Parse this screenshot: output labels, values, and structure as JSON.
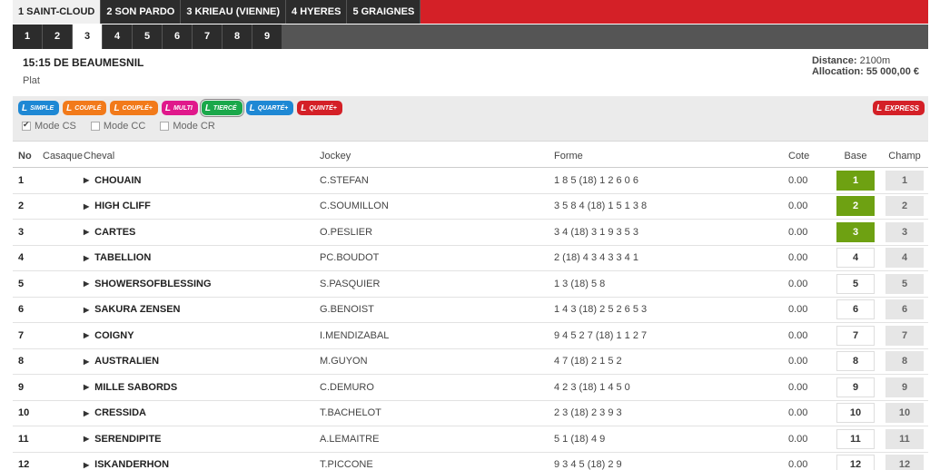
{
  "reunions": [
    {
      "label": "1 SAINT-CLOUD",
      "active": true
    },
    {
      "label": "2 SON PARDO",
      "active": false
    },
    {
      "label": "3 KRIEAU (VIENNE)",
      "active": false
    },
    {
      "label": "4 HYERES",
      "active": false
    },
    {
      "label": "5 GRAIGNES",
      "active": false
    }
  ],
  "courses": [
    "1",
    "2",
    "3",
    "4",
    "5",
    "6",
    "7",
    "8",
    "9"
  ],
  "active_course": "3",
  "race": {
    "title": "15:15 DE BEAUMESNIL",
    "type": "Plat",
    "distance_label": "Distance:",
    "distance_value": "2100m",
    "allocation_label": "Allocation:",
    "allocation_value": "55 000,00 €"
  },
  "bet_types": [
    {
      "label": "SIMPLE",
      "color": "#1e88d4",
      "selected": false
    },
    {
      "label": "COUPLÉ",
      "color": "#f27a1a",
      "selected": false
    },
    {
      "label": "COUPLÉ+",
      "color": "#f27a1a",
      "selected": false
    },
    {
      "label": "MULTI",
      "color": "#e0188b",
      "selected": false
    },
    {
      "label": "TIERCÉ",
      "color": "#1aa84a",
      "selected": true
    },
    {
      "label": "QUARTÉ+",
      "color": "#1e88d4",
      "selected": false
    },
    {
      "label": "QUINTÉ+",
      "color": "#d42027",
      "selected": false
    }
  ],
  "express_label": "EXPRESS",
  "modes": [
    {
      "label": "Mode CS",
      "checked": true
    },
    {
      "label": "Mode CC",
      "checked": false
    },
    {
      "label": "Mode CR",
      "checked": false
    }
  ],
  "table": {
    "headers": {
      "no": "No",
      "casaque": "Casaque",
      "cheval": "Cheval",
      "jockey": "Jockey",
      "forme": "Forme",
      "cote": "Cote",
      "base": "Base",
      "champ": "Champ"
    },
    "rows": [
      {
        "no": "1",
        "cheval": "CHOUAIN",
        "jockey": "C.STEFAN",
        "forme": "1 8 5 (18) 1 2 6 0 6",
        "cote": "0.00",
        "base": "1",
        "champ": "1",
        "selected": true
      },
      {
        "no": "2",
        "cheval": "HIGH CLIFF",
        "jockey": "C.SOUMILLON",
        "forme": "3 5 8 4 (18) 1 5 1 3 8",
        "cote": "0.00",
        "base": "2",
        "champ": "2",
        "selected": true
      },
      {
        "no": "3",
        "cheval": "CARTES",
        "jockey": "O.PESLIER",
        "forme": "3 4 (18) 3 1 9 3 5 3",
        "cote": "0.00",
        "base": "3",
        "champ": "3",
        "selected": true
      },
      {
        "no": "4",
        "cheval": "TABELLION",
        "jockey": "PC.BOUDOT",
        "forme": "2 (18) 4 3 4 3 3 4 1",
        "cote": "0.00",
        "base": "4",
        "champ": "4",
        "selected": false
      },
      {
        "no": "5",
        "cheval": "SHOWERSOFBLESSING",
        "jockey": "S.PASQUIER",
        "forme": "1 3 (18) 5 8",
        "cote": "0.00",
        "base": "5",
        "champ": "5",
        "selected": false
      },
      {
        "no": "6",
        "cheval": "SAKURA ZENSEN",
        "jockey": "G.BENOIST",
        "forme": "1 4 3 (18) 2 5 2 6 5 3",
        "cote": "0.00",
        "base": "6",
        "champ": "6",
        "selected": false
      },
      {
        "no": "7",
        "cheval": "COIGNY",
        "jockey": "I.MENDIZABAL",
        "forme": "9 4 5 2 7 (18) 1 1 2 7",
        "cote": "0.00",
        "base": "7",
        "champ": "7",
        "selected": false
      },
      {
        "no": "8",
        "cheval": "AUSTRALIEN",
        "jockey": "M.GUYON",
        "forme": "4 7 (18) 2 1 5 2",
        "cote": "0.00",
        "base": "8",
        "champ": "8",
        "selected": false
      },
      {
        "no": "9",
        "cheval": "MILLE SABORDS",
        "jockey": "C.DEMURO",
        "forme": "4 2 3 (18) 1 4 5 0",
        "cote": "0.00",
        "base": "9",
        "champ": "9",
        "selected": false
      },
      {
        "no": "10",
        "cheval": "CRESSIDA",
        "jockey": "T.BACHELOT",
        "forme": "2 3 (18) 2 3 9 3",
        "cote": "0.00",
        "base": "10",
        "champ": "10",
        "selected": false
      },
      {
        "no": "11",
        "cheval": "SERENDIPITE",
        "jockey": "A.LEMAITRE",
        "forme": "5 1 (18) 4 9",
        "cote": "0.00",
        "base": "11",
        "champ": "11",
        "selected": false
      },
      {
        "no": "12",
        "cheval": "ISKANDERHON",
        "jockey": "T.PICCONE",
        "forme": "9 3 4 5 (18) 2 9",
        "cote": "0.00",
        "base": "12",
        "champ": "12",
        "selected": false
      }
    ]
  }
}
